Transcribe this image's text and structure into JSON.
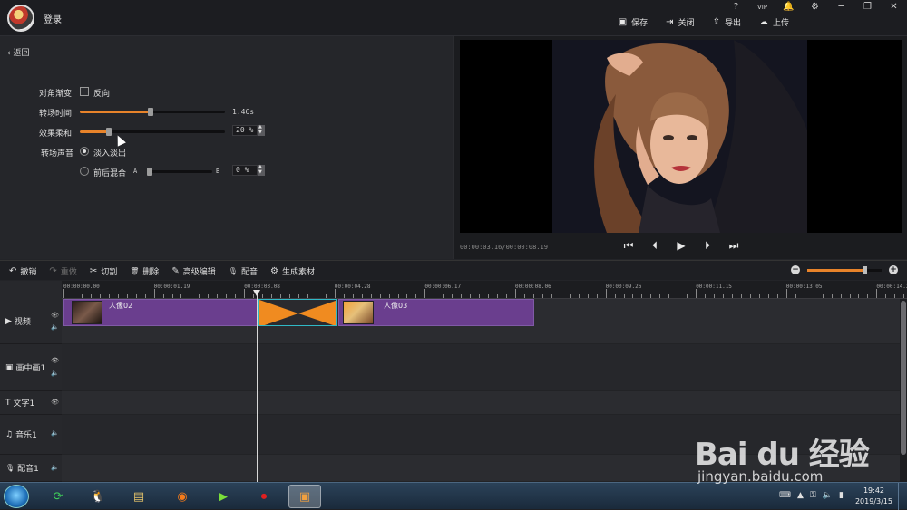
{
  "app": {
    "login_label": "登录",
    "top_icons": [
      "help-icon",
      "vip-icon",
      "bell-icon",
      "gear-icon",
      "minimize-icon",
      "restore-icon",
      "close-icon"
    ],
    "top_icon_glyphs": [
      "?",
      "VIP",
      "🔔",
      "⚙",
      "─",
      "❐",
      "✕"
    ],
    "actions": [
      {
        "label": "保存",
        "icon": "save-icon",
        "glyph": "▣"
      },
      {
        "label": "关闭",
        "icon": "exit-icon",
        "glyph": "⇥"
      },
      {
        "label": "导出",
        "icon": "export-icon",
        "glyph": "⇪"
      },
      {
        "label": "上传",
        "icon": "upload-cloud-icon",
        "glyph": "☁"
      }
    ]
  },
  "panel": {
    "back_label": "返回",
    "diagonal_label": "对角渐变",
    "reverse_label": "反向",
    "reverse_checked": false,
    "duration_label": "转场时间",
    "duration_value": "1.46s",
    "duration_fraction": 0.49,
    "softness_label": "效果柔和",
    "softness_value": "20 %",
    "softness_fraction": 0.2,
    "sound_label": "转场声音",
    "fade_label": "淡入淡出",
    "fade_selected": true,
    "mix_label": "前后混合",
    "mix_a": "A",
    "mix_b": "B",
    "mix_value": "0 %",
    "mix_fraction": 0.0
  },
  "preview": {
    "timecode": "00:00:03.16/00:00:08.19",
    "controls": [
      "skip-start-icon",
      "step-back-icon",
      "play-icon",
      "step-forward-icon",
      "skip-end-icon"
    ],
    "control_glyphs": [
      "⏮",
      "⏴",
      "▶",
      "⏵",
      "⏭"
    ]
  },
  "toolbar": {
    "tools": [
      {
        "label": "撤销",
        "icon": "undo-icon",
        "glyph": "↶",
        "enabled": true
      },
      {
        "label": "重做",
        "icon": "redo-icon",
        "glyph": "↷",
        "enabled": false
      },
      {
        "label": "切割",
        "icon": "scissors-icon",
        "glyph": "✂",
        "enabled": true
      },
      {
        "label": "删除",
        "icon": "trash-icon",
        "glyph": "🗑",
        "enabled": true
      },
      {
        "label": "高级编辑",
        "icon": "pencil-icon",
        "glyph": "✎",
        "enabled": true
      },
      {
        "label": "配音",
        "icon": "microphone-icon",
        "glyph": "🎙",
        "enabled": true
      },
      {
        "label": "生成素材",
        "icon": "film-reel-icon",
        "glyph": "⚙",
        "enabled": true
      }
    ],
    "zoom_fraction": 0.78
  },
  "timeline": {
    "ruler_ticks": [
      "00:00:00.00",
      "00:00:01.19",
      "00:00:03.08",
      "00:00:04.28",
      "00:00:06.17",
      "00:00:08.06",
      "00:00:09.26",
      "00:00:11.15",
      "00:00:13.05",
      "00:00:14.24"
    ],
    "tracks": [
      {
        "label": "视频",
        "icon": "video-track-icon",
        "glyph": "▶"
      },
      {
        "label": "画中画1",
        "icon": "pip-track-icon",
        "glyph": "▣"
      },
      {
        "label": "文字1",
        "icon": "text-track-icon",
        "glyph": "T"
      },
      {
        "label": "音乐1",
        "icon": "music-track-icon",
        "glyph": "♫"
      },
      {
        "label": "配音1",
        "icon": "voice-track-icon",
        "glyph": "🎙"
      }
    ],
    "clips": [
      {
        "label": "人像02"
      },
      {
        "label": "人像03"
      }
    ]
  },
  "taskbar": {
    "apps": [
      "start-orb-icon",
      "refresh-app-icon",
      "qq-icon",
      "file-explorer-icon",
      "firefox-icon",
      "media-player-icon",
      "record-icon",
      "video-editor-icon"
    ],
    "time": "19:42",
    "date": "2019/3/15"
  },
  "watermark": {
    "main": "Bai du 经验",
    "sub": "jingyan.baidu.com"
  }
}
